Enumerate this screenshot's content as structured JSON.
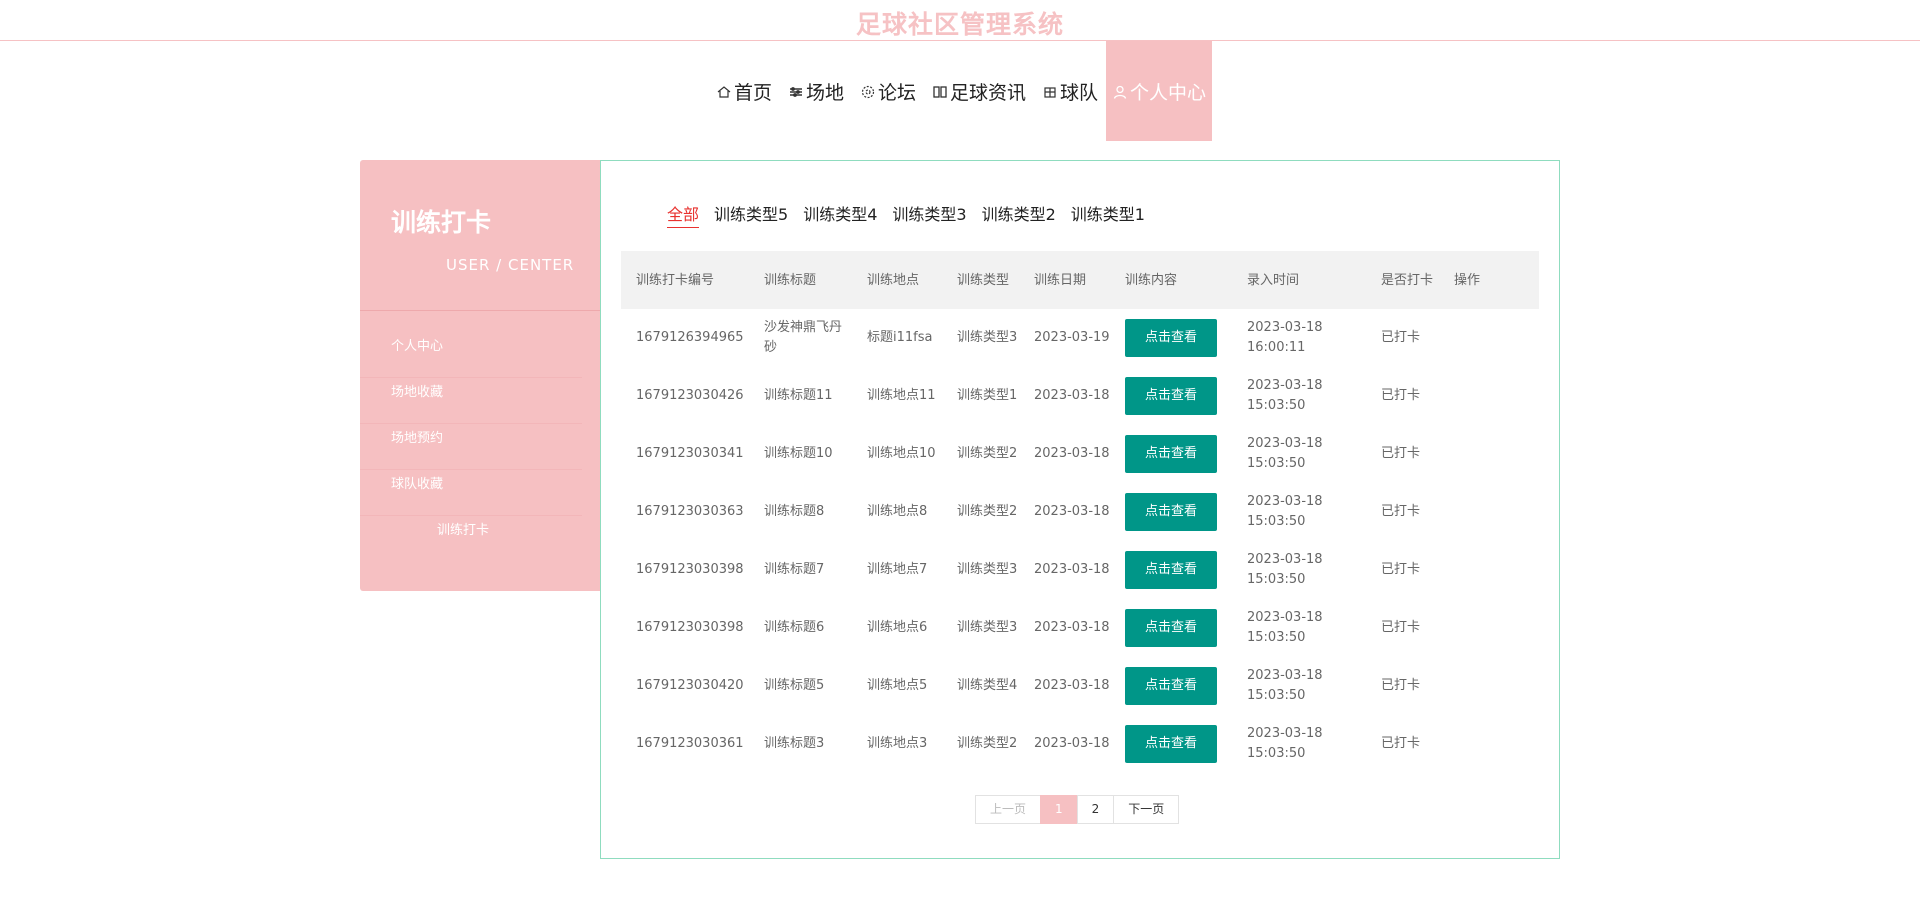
{
  "site": {
    "title": "足球社区管理系统"
  },
  "nav": [
    {
      "label": "首页",
      "icon": "home-icon"
    },
    {
      "label": "场地",
      "icon": "field-icon"
    },
    {
      "label": "论坛",
      "icon": "forum-icon"
    },
    {
      "label": "足球资讯",
      "icon": "news-icon"
    },
    {
      "label": "球队",
      "icon": "team-icon"
    },
    {
      "label": "个人中心",
      "icon": "user-icon"
    }
  ],
  "sidebar": {
    "title": "训练打卡",
    "subtitle": "USER / CENTER",
    "items": [
      "个人中心",
      "场地收藏",
      "场地预约",
      "球队收藏",
      "训练打卡"
    ]
  },
  "filters": [
    "全部",
    "训练类型5",
    "训练类型4",
    "训练类型3",
    "训练类型2",
    "训练类型1"
  ],
  "table": {
    "headers": [
      "训练打卡编号",
      "训练标题",
      "训练地点",
      "训练类型",
      "训练日期",
      "训练内容",
      "录入时间",
      "是否打卡",
      "操作"
    ],
    "rows": [
      {
        "id": "1679126394965",
        "title": "沙发神鼎飞丹砂",
        "place": "标题i11fsa",
        "type": "训练类型3",
        "date": "2023-03-19",
        "content": "点击查看",
        "time": "2023-03-18 16:00:11",
        "checked": "已打卡"
      },
      {
        "id": "1679123030426",
        "title": "训练标题11",
        "place": "训练地点11",
        "type": "训练类型1",
        "date": "2023-03-18",
        "content": "点击查看",
        "time": "2023-03-18 15:03:50",
        "checked": "已打卡"
      },
      {
        "id": "1679123030341",
        "title": "训练标题10",
        "place": "训练地点10",
        "type": "训练类型2",
        "date": "2023-03-18",
        "content": "点击查看",
        "time": "2023-03-18 15:03:50",
        "checked": "已打卡"
      },
      {
        "id": "1679123030363",
        "title": "训练标题8",
        "place": "训练地点8",
        "type": "训练类型2",
        "date": "2023-03-18",
        "content": "点击查看",
        "time": "2023-03-18 15:03:50",
        "checked": "已打卡"
      },
      {
        "id": "1679123030398",
        "title": "训练标题7",
        "place": "训练地点7",
        "type": "训练类型3",
        "date": "2023-03-18",
        "content": "点击查看",
        "time": "2023-03-18 15:03:50",
        "checked": "已打卡"
      },
      {
        "id": "1679123030398",
        "title": "训练标题6",
        "place": "训练地点6",
        "type": "训练类型3",
        "date": "2023-03-18",
        "content": "点击查看",
        "time": "2023-03-18 15:03:50",
        "checked": "已打卡"
      },
      {
        "id": "1679123030420",
        "title": "训练标题5",
        "place": "训练地点5",
        "type": "训练类型4",
        "date": "2023-03-18",
        "content": "点击查看",
        "time": "2023-03-18 15:03:50",
        "checked": "已打卡"
      },
      {
        "id": "1679123030361",
        "title": "训练标题3",
        "place": "训练地点3",
        "type": "训练类型2",
        "date": "2023-03-18",
        "content": "点击查看",
        "time": "2023-03-18 15:03:50",
        "checked": "已打卡"
      }
    ]
  },
  "pager": {
    "prev": "上一页",
    "pages": [
      "1",
      "2"
    ],
    "next": "下一页"
  },
  "colors": {
    "brand": "#f6c0c2",
    "accent": "#009688",
    "filter_active": "#e8322f"
  }
}
